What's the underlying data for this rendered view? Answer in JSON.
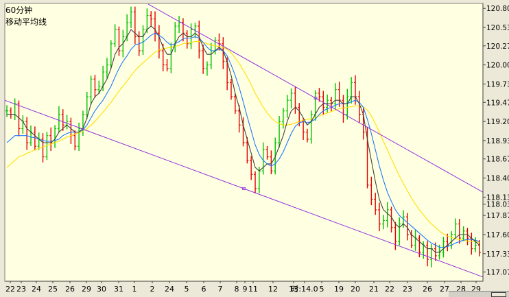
{
  "panel": {
    "period_label": "60分钟",
    "indicator_label": "移动平均线"
  },
  "colors": {
    "background": "#ffffe1",
    "up_bar": "#00c000",
    "down_bar": "#e00000",
    "ma_short": "#404040",
    "ma_mid": "#1e78ff",
    "ma_long": "#ffe000",
    "channel": "#9030e0",
    "grid": "#d8d0a0"
  },
  "chart_data": {
    "type": "line",
    "yaxis": {
      "ticks": [
        "120.80",
        "120.53",
        "120.27",
        "120.00",
        "119.73",
        "119.47",
        "119.20",
        "118.93",
        "118.67",
        "118.40",
        "118.13",
        "118.03",
        "117.87",
        "117.60",
        "117.33",
        "117.07"
      ],
      "range": [
        116.94,
        120.87
      ]
    },
    "xaxis": {
      "labels": [
        "22",
        "23",
        "24",
        "25",
        "26",
        "29",
        "30",
        "31",
        "1",
        "2",
        "24",
        "5",
        "6",
        "7",
        "8",
        "9",
        "11",
        "12",
        "13",
        "时:14.0",
        "5",
        "19",
        "20",
        "21",
        "22",
        "23",
        "26",
        "27",
        "28",
        "29"
      ]
    },
    "series": [
      {
        "role": "price-bars",
        "values": [
          119.35,
          119.3,
          119.45,
          119.1,
          119.2,
          118.9,
          119.05,
          118.85,
          118.95,
          118.7,
          119.0,
          118.9,
          119.1,
          119.3,
          119.15,
          119.2,
          119.0,
          118.85,
          119.1,
          119.3,
          119.55,
          119.8,
          119.65,
          119.7,
          119.9,
          120.0,
          120.3,
          120.5,
          120.2,
          120.4,
          120.6,
          120.75,
          120.4,
          120.2,
          120.5,
          120.7,
          120.65,
          120.45,
          120.2,
          120.0,
          119.95,
          120.25,
          120.55,
          120.6,
          120.45,
          120.3,
          120.5,
          120.55,
          120.2,
          119.95,
          120.0,
          120.2,
          120.35,
          120.3,
          120.05,
          119.75,
          119.55,
          119.35,
          119.15,
          118.9,
          118.65,
          118.45,
          118.25,
          118.5,
          118.8,
          118.7,
          118.5,
          118.9,
          119.2,
          119.35,
          119.5,
          119.6,
          119.4,
          119.2,
          119.05,
          118.95,
          119.3,
          119.6,
          119.55,
          119.4,
          119.5,
          119.45,
          119.65,
          119.5,
          119.3,
          119.55,
          119.75,
          119.55,
          119.3,
          119.05,
          118.3,
          118.1,
          117.95,
          117.75,
          117.8,
          117.95,
          117.7,
          117.5,
          117.75,
          117.85,
          117.6,
          117.45,
          117.55,
          117.35,
          117.45,
          117.25,
          117.4,
          117.3,
          117.35,
          117.5,
          117.45,
          117.6,
          117.75,
          117.55,
          117.65,
          117.55,
          117.4,
          117.45,
          117.35
        ]
      },
      {
        "role": "ma-short",
        "values": [
          119.3,
          119.3,
          119.3,
          119.25,
          119.2,
          119.1,
          119.05,
          119.0,
          118.95,
          118.9,
          118.9,
          118.9,
          118.95,
          119.05,
          119.1,
          119.15,
          119.1,
          119.05,
          119.05,
          119.1,
          119.25,
          119.45,
          119.55,
          119.6,
          119.7,
          119.8,
          119.95,
          120.15,
          120.25,
          120.3,
          120.4,
          120.5,
          120.45,
          120.4,
          120.4,
          120.5,
          120.55,
          120.5,
          120.4,
          120.25,
          120.15,
          120.15,
          120.3,
          120.4,
          120.45,
          120.4,
          120.4,
          120.45,
          120.4,
          120.25,
          120.15,
          120.15,
          120.2,
          120.25,
          120.2,
          120.05,
          119.85,
          119.6,
          119.4,
          119.15,
          118.95,
          118.75,
          118.55,
          118.5,
          118.55,
          118.6,
          118.6,
          118.7,
          118.85,
          119.0,
          119.2,
          119.35,
          119.4,
          119.35,
          119.25,
          119.15,
          119.2,
          119.3,
          119.4,
          119.45,
          119.45,
          119.45,
          119.5,
          119.5,
          119.45,
          119.45,
          119.55,
          119.55,
          119.45,
          119.3,
          118.95,
          118.65,
          118.35,
          118.1,
          117.95,
          117.9,
          117.85,
          117.75,
          117.7,
          117.75,
          117.7,
          117.6,
          117.55,
          117.5,
          117.45,
          117.4,
          117.4,
          117.35,
          117.35,
          117.4,
          117.45,
          117.5,
          117.55,
          117.6,
          117.6,
          117.6,
          117.55,
          117.5,
          117.45
        ]
      },
      {
        "role": "ma-mid",
        "values": [
          118.9,
          118.95,
          119.0,
          119.0,
          119.0,
          119.0,
          118.98,
          118.97,
          118.95,
          118.93,
          118.92,
          118.92,
          118.93,
          118.95,
          119.0,
          119.03,
          119.05,
          119.05,
          119.05,
          119.08,
          119.15,
          119.25,
          119.35,
          119.43,
          119.5,
          119.6,
          119.7,
          119.83,
          119.95,
          120.05,
          120.13,
          120.22,
          120.28,
          120.3,
          120.32,
          120.37,
          120.42,
          120.45,
          120.42,
          120.38,
          120.32,
          120.28,
          120.3,
          120.33,
          120.37,
          120.38,
          120.38,
          120.4,
          120.38,
          120.32,
          120.25,
          120.2,
          120.2,
          120.22,
          120.2,
          120.13,
          120.0,
          119.85,
          119.68,
          119.48,
          119.27,
          119.07,
          118.87,
          118.73,
          118.65,
          118.6,
          118.57,
          118.6,
          118.67,
          118.77,
          118.9,
          119.03,
          119.13,
          119.18,
          119.2,
          119.18,
          119.2,
          119.23,
          119.3,
          119.35,
          119.38,
          119.4,
          119.43,
          119.45,
          119.45,
          119.45,
          119.48,
          119.5,
          119.47,
          119.4,
          119.23,
          119.03,
          118.8,
          118.57,
          118.37,
          118.2,
          118.07,
          117.95,
          117.87,
          117.82,
          117.77,
          117.72,
          117.67,
          117.62,
          117.57,
          117.52,
          117.48,
          117.45,
          117.42,
          117.42,
          117.43,
          117.45,
          117.48,
          117.5,
          117.52,
          117.53,
          117.53,
          117.52,
          117.5
        ]
      },
      {
        "role": "ma-long",
        "values": [
          118.55,
          118.6,
          118.65,
          118.7,
          118.72,
          118.75,
          118.77,
          118.8,
          118.82,
          118.84,
          118.86,
          118.88,
          118.9,
          118.92,
          118.95,
          118.98,
          119.0,
          119.02,
          119.04,
          119.06,
          119.1,
          119.15,
          119.2,
          119.27,
          119.33,
          119.4,
          119.47,
          119.55,
          119.63,
          119.7,
          119.77,
          119.85,
          119.92,
          119.98,
          120.03,
          120.08,
          120.13,
          120.18,
          120.21,
          120.23,
          120.24,
          120.25,
          120.26,
          120.28,
          120.3,
          120.31,
          120.32,
          120.33,
          120.33,
          120.32,
          120.3,
          120.28,
          120.27,
          120.26,
          120.25,
          120.22,
          120.17,
          120.1,
          120.02,
          119.93,
          119.83,
          119.72,
          119.6,
          119.5,
          119.4,
          119.32,
          119.25,
          119.2,
          119.17,
          119.15,
          119.15,
          119.16,
          119.18,
          119.2,
          119.22,
          119.23,
          119.24,
          119.26,
          119.28,
          119.3,
          119.32,
          119.34,
          119.36,
          119.38,
          119.39,
          119.4,
          119.41,
          119.42,
          119.42,
          119.41,
          119.36,
          119.28,
          119.17,
          119.05,
          118.92,
          118.8,
          118.67,
          118.55,
          118.43,
          118.32,
          118.22,
          118.12,
          118.03,
          117.95,
          117.88,
          117.81,
          117.75,
          117.7,
          117.65,
          117.61,
          117.58,
          117.56,
          117.54,
          117.53,
          117.52,
          117.51,
          117.5,
          117.5,
          117.49
        ]
      }
    ],
    "channel_lines": [
      {
        "role": "upper-trendline",
        "from": [
          0.3,
          120.86
        ],
        "to": [
          1.0,
          118.2
        ]
      },
      {
        "role": "lower-trendline",
        "from": [
          0.0,
          119.5
        ],
        "to": [
          1.0,
          117.0
        ]
      }
    ],
    "grid": false,
    "legend": "none"
  }
}
